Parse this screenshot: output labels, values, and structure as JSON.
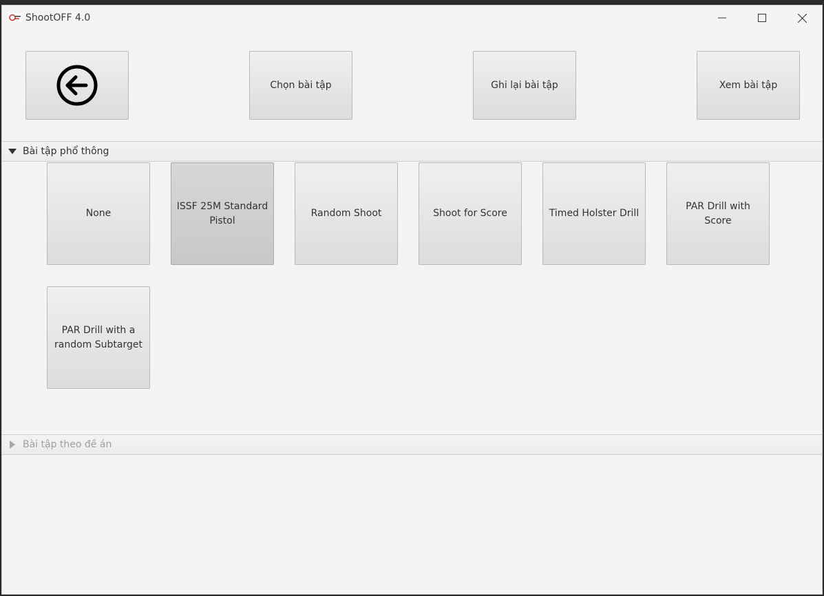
{
  "window": {
    "title": "ShootOFF 4.0"
  },
  "toolbar": {
    "back_icon": "arrow-left-circle-icon",
    "choose_label": "Chọn bài tập",
    "record_label": "Ghi lại bài tập",
    "view_label": "Xem bài tập"
  },
  "sections": {
    "common": {
      "title": "Bài tập phổ thông",
      "expanded": true,
      "selected": "ISSF 25M Standard Pistol",
      "items": [
        {
          "label": "None"
        },
        {
          "label": "ISSF 25M Standard Pistol"
        },
        {
          "label": "Random Shoot"
        },
        {
          "label": "Shoot for Score"
        },
        {
          "label": "Timed Holster Drill"
        },
        {
          "label": "PAR Drill with Score"
        },
        {
          "label": "PAR Drill with a random Subtarget"
        }
      ]
    },
    "project": {
      "title": "Bài tập theo đề án",
      "expanded": false
    }
  },
  "colors": {
    "window_bg": "#f4f4f4",
    "button_bg": "#e4e4e4",
    "button_pressed_bg": "#cdcdcd",
    "disabled_text": "#a0a0a0"
  }
}
